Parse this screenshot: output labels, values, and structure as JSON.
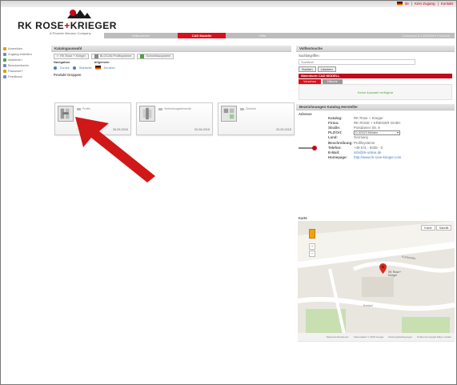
{
  "top_bar": {
    "lang": "de",
    "links": [
      "Kein Zugang",
      "Kontakt"
    ]
  },
  "logo": {
    "brand": "RK ROSE",
    "brand_plus": "+",
    "brand_suffix": "KRIEGER",
    "sub": "A Phoenix Mecano Company"
  },
  "nav": {
    "tabs": [
      "Willkommen",
      "CAD Modelle",
      "Hilfe"
    ],
    "active_tab": "CAD Modelle",
    "right_text": "Download & CADENAS Produkte"
  },
  "sidebar": {
    "items": [
      {
        "label": "Anmelden",
        "icon": "login-icon",
        "color": "#d6a012"
      },
      {
        "label": "Zugang erstellen",
        "icon": "user-add-icon",
        "color": "#6c8ebf"
      },
      {
        "label": "Aktivieren",
        "icon": "check-icon",
        "color": "#4aa833"
      },
      {
        "label": "Benutzerkonto",
        "icon": "account-icon",
        "color": "#6c8ebf"
      },
      {
        "label": "Passwort?",
        "icon": "key-icon",
        "color": "#d6a012"
      },
      {
        "label": "Feedback",
        "icon": "feedback-icon",
        "color": "#6c8ebf"
      }
    ]
  },
  "catalog": {
    "header": "Katalogauswahl",
    "toolbar": [
      "RK Rose + Krieger",
      "BLOCAN Profilsysteme",
      "Schnellbausystem"
    ],
    "sections": [
      "Navigation",
      "Allgemein"
    ],
    "nav_links": [
      "Zurück",
      "Startseite",
      "Deutsch"
    ],
    "groups_header": "Produkt Gruppen",
    "cards": [
      {
        "title": "Profile",
        "date": "26.05.2015"
      },
      {
        "title": "Verbindungselemente",
        "date": "02.06.2015"
      },
      {
        "title": "Zubehör",
        "date": "20.05.2015"
      }
    ]
  },
  "search": {
    "header": "Volltextsuche",
    "label": "Suchbegriffen",
    "placeholder": "Suchtext",
    "buttons": [
      "Suchen",
      "Löschen"
    ],
    "cad_bar": "Warenkorb CAD MODELL",
    "tabs": [
      "Vorschau",
      "Historie"
    ],
    "message": "Keine Auswahl verfügbar"
  },
  "vendor": {
    "header": "Bezeichnungen Katalog Hersteller",
    "address_label": "Adresse",
    "rows": [
      {
        "k": "Katalog:",
        "v": "RK Rose + Krieger"
      },
      {
        "k": "Firma:",
        "v": "RK ROSE + KRIEGER GmbH"
      },
      {
        "k": "Straße:",
        "v": "Potsdamer Str. 9"
      },
      {
        "k": "Land:",
        "v": "Germany"
      },
      {
        "k": "Beschreibung:",
        "v": "Profilsysteme"
      },
      {
        "k": "Telefon:",
        "v": "+49 571 - 9335 - 0"
      },
      {
        "k": "E-Mail:",
        "v": "info@rk-online.de"
      },
      {
        "k": "Homepage:",
        "v": "http://www.rk-rose-krieger.com"
      }
    ],
    "plz_label": "PLZ/Ort:",
    "plz_value": "D-32423 Minden"
  },
  "map": {
    "label": "Karte",
    "type_buttons": [
      "Karte",
      "Satellit"
    ],
    "street_labels": [
      "Karlstraße",
      "Kreisel"
    ],
    "pin_label": "RK Rose+ Krieger",
    "footer": [
      "Tastenkombinationen",
      "Kartendaten © 2015 Google",
      "Nutzungsbedingungen",
      "Fehler bei Google Maps melden"
    ]
  }
}
